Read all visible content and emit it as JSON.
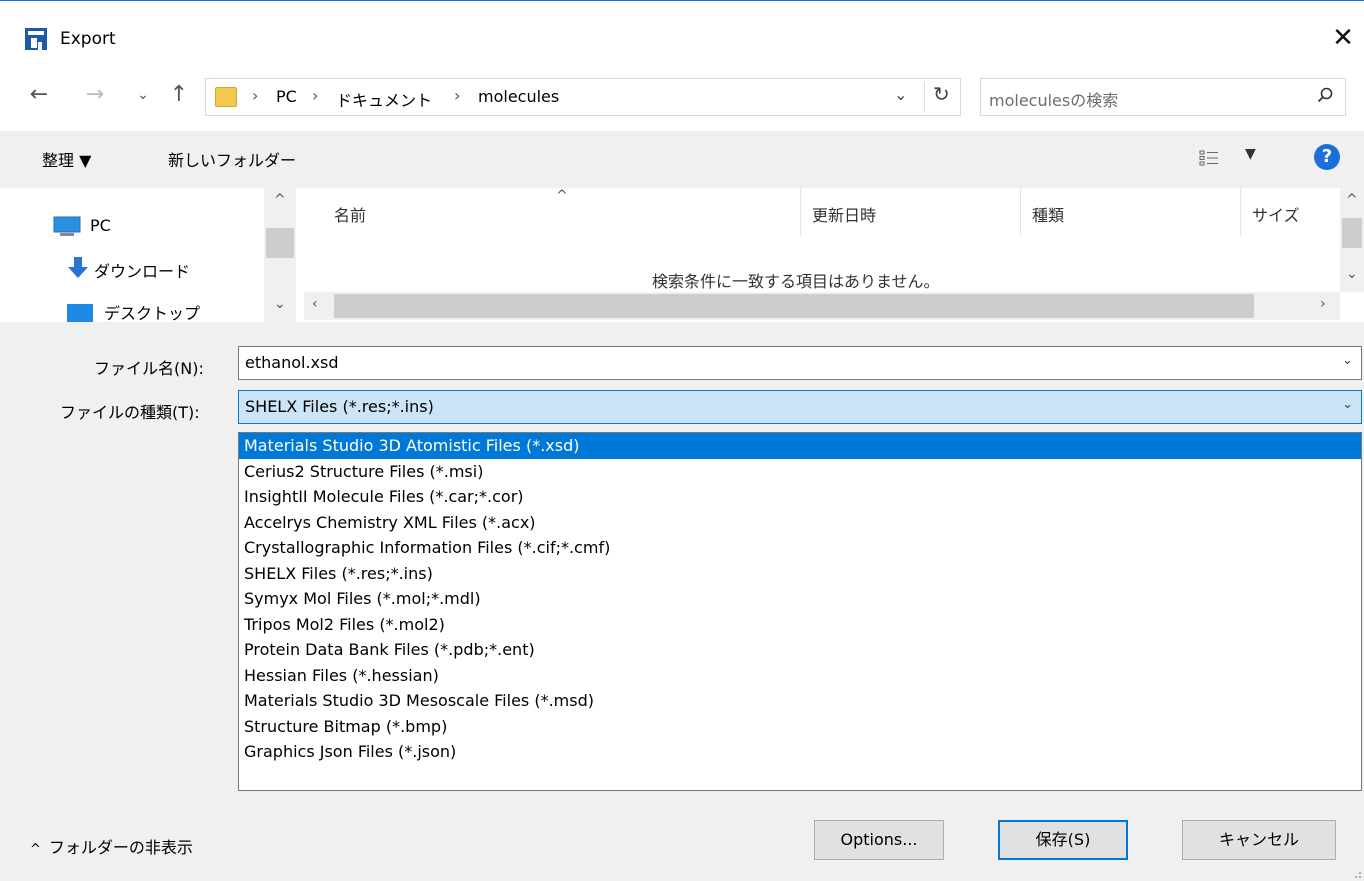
{
  "window": {
    "title": "Export"
  },
  "nav": {
    "back": "←",
    "forward": "→",
    "recent": "⌄",
    "up": "↑",
    "crumbs": [
      "PC",
      "ドキュメント",
      "molecules"
    ],
    "separator": "›",
    "search_placeholder": "moleculesの検索"
  },
  "toolbar": {
    "organize": "整理 ▼",
    "new_folder": "新しいフォルダー",
    "help": "?"
  },
  "nav_pane": {
    "items": [
      "PC",
      "ダウンロード",
      "デスクトップ"
    ]
  },
  "columns": [
    "名前",
    "更新日時",
    "種類",
    "サイズ"
  ],
  "empty_message": "検索条件に一致する項目はありません。",
  "form": {
    "filename_label": "ファイル名(N):",
    "filename_value": "ethanol.xsd",
    "filetype_label": "ファイルの種類(T):",
    "filetype_value": "SHELX Files (*.res;*.ins)"
  },
  "filetype_options": [
    "Materials Studio 3D Atomistic Files (*.xsd)",
    "Cerius2 Structure Files (*.msi)",
    "InsightII Molecule Files (*.car;*.cor)",
    "Accelrys Chemistry XML Files (*.acx)",
    "Crystallographic Information Files (*.cif;*.cmf)",
    "SHELX Files (*.res;*.ins)",
    "Symyx Mol Files (*.mol;*.mdl)",
    "Tripos Mol2 Files (*.mol2)",
    "Protein Data Bank Files (*.pdb;*.ent)",
    "Hessian Files (*.hessian)",
    "Materials Studio 3D Mesoscale Files (*.msd)",
    "Structure Bitmap (*.bmp)",
    "Graphics Json Files (*.json)"
  ],
  "footer": {
    "hide_folders": "フォルダーの非表示",
    "options": "Options...",
    "save": "保存(S)",
    "cancel": "キャンセル"
  },
  "colors": {
    "accent": "#0078d7",
    "selection_bg": "#0078d7",
    "field_focus_bg": "#cce4f7"
  }
}
